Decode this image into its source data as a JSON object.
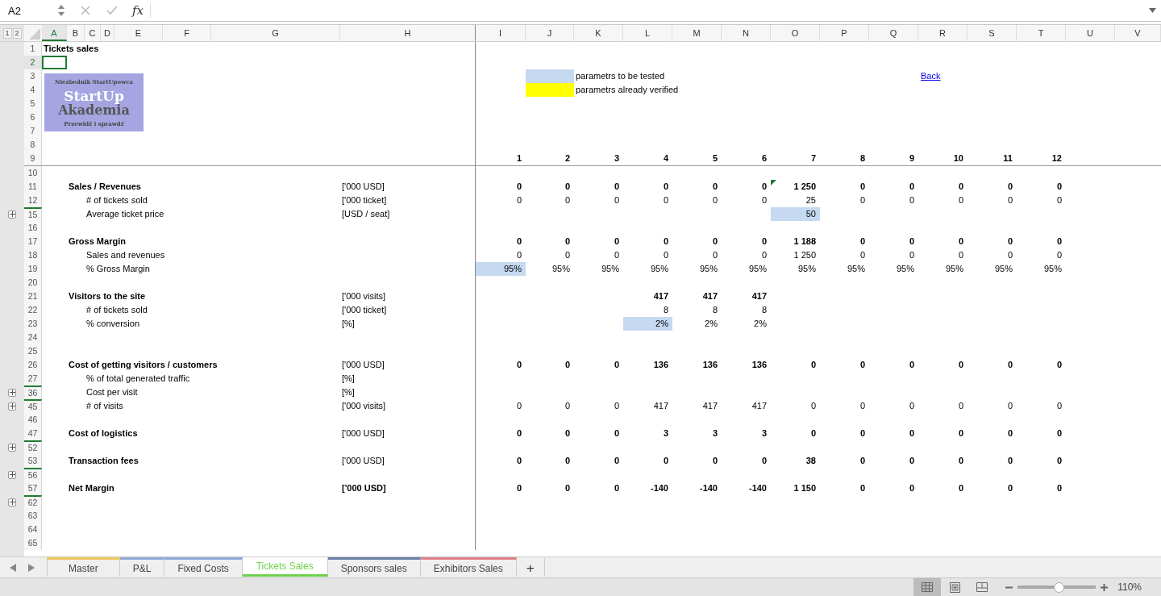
{
  "formula_bar": {
    "name_box": "A2",
    "function_label": "fx"
  },
  "outline_levels": [
    "1",
    "2"
  ],
  "logo": {
    "tagline": "Niezbednik StartUpowca",
    "title": "StartUp",
    "subtitle": "Akademia",
    "motto": "Przewidź i sprawdź"
  },
  "sheet": {
    "columns": [
      {
        "letter": "A",
        "selected": true
      },
      {
        "letter": "B",
        "selected": false
      },
      {
        "letter": "C",
        "selected": false
      },
      {
        "letter": "D",
        "selected": false
      },
      {
        "letter": "E",
        "selected": false
      },
      {
        "letter": "F",
        "selected": false
      },
      {
        "letter": "G",
        "selected": false
      },
      {
        "letter": "H",
        "selected": false
      },
      {
        "letter": "I",
        "selected": false
      },
      {
        "letter": "J",
        "selected": false
      },
      {
        "letter": "K",
        "selected": false
      },
      {
        "letter": "L",
        "selected": false
      },
      {
        "letter": "M",
        "selected": false
      },
      {
        "letter": "N",
        "selected": false
      },
      {
        "letter": "O",
        "selected": false
      },
      {
        "letter": "P",
        "selected": false
      },
      {
        "letter": "Q",
        "selected": false
      },
      {
        "letter": "R",
        "selected": false
      },
      {
        "letter": "S",
        "selected": false
      },
      {
        "letter": "T",
        "selected": false
      },
      {
        "letter": "U",
        "selected": false
      },
      {
        "letter": "V",
        "selected": false
      }
    ],
    "rows": [
      {
        "number": "1",
        "selected": false,
        "collapsed": false,
        "kind": "title",
        "label": "Tickets sales"
      },
      {
        "number": "2",
        "selected": true,
        "collapsed": false,
        "kind": "plain"
      },
      {
        "number": "3",
        "selected": false,
        "collapsed": false,
        "kind": "plain",
        "legend": {
          "color": "#c5d9f1",
          "text": "parametrs to be tested"
        },
        "link": "Back"
      },
      {
        "number": "4",
        "selected": false,
        "collapsed": false,
        "kind": "plain",
        "legend": {
          "color": "#ffff00",
          "text": "parametrs already verified"
        }
      },
      {
        "number": "5",
        "selected": false,
        "collapsed": false,
        "kind": "plain"
      },
      {
        "number": "6",
        "selected": false,
        "collapsed": false,
        "kind": "plain"
      },
      {
        "number": "7",
        "selected": false,
        "collapsed": false,
        "kind": "plain"
      },
      {
        "number": "8",
        "selected": false,
        "collapsed": false,
        "kind": "plain"
      },
      {
        "number": "9",
        "selected": false,
        "collapsed": false,
        "kind": "period",
        "cells": [
          {
            "text": "1"
          },
          {
            "text": "2"
          },
          {
            "text": "3"
          },
          {
            "text": "4"
          },
          {
            "text": "5"
          },
          {
            "text": "6"
          },
          {
            "text": "7"
          },
          {
            "text": "8"
          },
          {
            "text": "9"
          },
          {
            "text": "10"
          },
          {
            "text": "11"
          },
          {
            "text": "12"
          }
        ]
      },
      {
        "number": "10",
        "selected": false,
        "collapsed": false,
        "kind": "plain"
      },
      {
        "number": "11",
        "selected": false,
        "collapsed": false,
        "kind": "heading",
        "label": "Sales / Revenues",
        "unit": "['000 USD]",
        "cells": [
          {
            "text": "0"
          },
          {
            "text": "0"
          },
          {
            "text": "0"
          },
          {
            "text": "0"
          },
          {
            "text": "0"
          },
          {
            "text": "0"
          },
          {
            "text": "1 250",
            "flagged": true
          },
          {
            "text": "0"
          },
          {
            "text": "0"
          },
          {
            "text": "0"
          },
          {
            "text": "0"
          },
          {
            "text": "0"
          }
        ]
      },
      {
        "number": "12",
        "selected": false,
        "collapsed": false,
        "kind": "item",
        "label": "# of tickets sold",
        "unit": "['000 ticket]",
        "cells": [
          {
            "text": "0"
          },
          {
            "text": "0"
          },
          {
            "text": "0"
          },
          {
            "text": "0"
          },
          {
            "text": "0"
          },
          {
            "text": "0"
          },
          {
            "text": "25"
          },
          {
            "text": "0"
          },
          {
            "text": "0"
          },
          {
            "text": "0"
          },
          {
            "text": "0"
          },
          {
            "text": "0"
          }
        ]
      },
      {
        "number": "15",
        "selected": false,
        "collapsed": true,
        "kind": "item",
        "label": "Average ticket price",
        "unit": "[USD / seat]",
        "cells": [
          null,
          null,
          null,
          null,
          null,
          null,
          {
            "text": "50",
            "highlighted": true
          },
          null,
          null,
          null,
          null,
          null
        ]
      },
      {
        "number": "16",
        "selected": false,
        "collapsed": false,
        "kind": "plain"
      },
      {
        "number": "17",
        "selected": false,
        "collapsed": false,
        "kind": "heading",
        "label": "Gross Margin",
        "cells": [
          {
            "text": "0"
          },
          {
            "text": "0"
          },
          {
            "text": "0"
          },
          {
            "text": "0"
          },
          {
            "text": "0"
          },
          {
            "text": "0"
          },
          {
            "text": "1 188"
          },
          {
            "text": "0"
          },
          {
            "text": "0"
          },
          {
            "text": "0"
          },
          {
            "text": "0"
          },
          {
            "text": "0"
          }
        ]
      },
      {
        "number": "18",
        "selected": false,
        "collapsed": false,
        "kind": "item",
        "label": "Sales and revenues",
        "cells": [
          {
            "text": "0"
          },
          {
            "text": "0"
          },
          {
            "text": "0"
          },
          {
            "text": "0"
          },
          {
            "text": "0"
          },
          {
            "text": "0"
          },
          {
            "text": "1 250"
          },
          {
            "text": "0"
          },
          {
            "text": "0"
          },
          {
            "text": "0"
          },
          {
            "text": "0"
          },
          {
            "text": "0"
          }
        ]
      },
      {
        "number": "19",
        "selected": false,
        "collapsed": false,
        "kind": "item",
        "label": "% Gross Margin",
        "cells": [
          {
            "text": "95%",
            "highlighted": true
          },
          {
            "text": "95%"
          },
          {
            "text": "95%"
          },
          {
            "text": "95%"
          },
          {
            "text": "95%"
          },
          {
            "text": "95%"
          },
          {
            "text": "95%"
          },
          {
            "text": "95%"
          },
          {
            "text": "95%"
          },
          {
            "text": "95%"
          },
          {
            "text": "95%"
          },
          {
            "text": "95%"
          }
        ]
      },
      {
        "number": "20",
        "selected": false,
        "collapsed": false,
        "kind": "plain"
      },
      {
        "number": "21",
        "selected": false,
        "collapsed": false,
        "kind": "heading",
        "label": "Visitors to the site",
        "unit": "['000 visits]",
        "cells": [
          null,
          null,
          null,
          {
            "text": "417"
          },
          {
            "text": "417"
          },
          {
            "text": "417"
          },
          null,
          null,
          null,
          null,
          null,
          null
        ]
      },
      {
        "number": "22",
        "selected": false,
        "collapsed": false,
        "kind": "item",
        "label": "# of tickets sold",
        "unit": "['000 ticket]",
        "cells": [
          null,
          null,
          null,
          {
            "text": "8"
          },
          {
            "text": "8"
          },
          {
            "text": "8"
          },
          null,
          null,
          null,
          null,
          null,
          null
        ]
      },
      {
        "number": "23",
        "selected": false,
        "collapsed": false,
        "kind": "item",
        "label": "% conversion",
        "unit": "[%]",
        "cells": [
          null,
          null,
          null,
          {
            "text": "2%",
            "highlighted": true
          },
          {
            "text": "2%"
          },
          {
            "text": "2%"
          },
          null,
          null,
          null,
          null,
          null,
          null
        ]
      },
      {
        "number": "24",
        "selected": false,
        "collapsed": false,
        "kind": "plain"
      },
      {
        "number": "25",
        "selected": false,
        "collapsed": false,
        "kind": "plain"
      },
      {
        "number": "26",
        "selected": false,
        "collapsed": false,
        "kind": "heading",
        "label": "Cost of getting visitors / customers",
        "unit": "['000 USD]",
        "cells": [
          {
            "text": "0"
          },
          {
            "text": "0"
          },
          {
            "text": "0"
          },
          {
            "text": "136"
          },
          {
            "text": "136"
          },
          {
            "text": "136"
          },
          {
            "text": "0"
          },
          {
            "text": "0"
          },
          {
            "text": "0"
          },
          {
            "text": "0"
          },
          {
            "text": "0"
          },
          {
            "text": "0"
          }
        ]
      },
      {
        "number": "27",
        "selected": false,
        "collapsed": false,
        "kind": "item",
        "label": "% of total generated traffic",
        "unit": "[%]"
      },
      {
        "number": "36",
        "selected": false,
        "collapsed": true,
        "kind": "item",
        "label": "Cost per visit",
        "unit": "[%]"
      },
      {
        "number": "45",
        "selected": false,
        "collapsed": true,
        "kind": "item",
        "label": "# of visits",
        "unit": "['000 visits]",
        "cells": [
          {
            "text": "0"
          },
          {
            "text": "0"
          },
          {
            "text": "0"
          },
          {
            "text": "417"
          },
          {
            "text": "417"
          },
          {
            "text": "417"
          },
          {
            "text": "0"
          },
          {
            "text": "0"
          },
          {
            "text": "0"
          },
          {
            "text": "0"
          },
          {
            "text": "0"
          },
          {
            "text": "0"
          }
        ]
      },
      {
        "number": "46",
        "selected": false,
        "collapsed": false,
        "kind": "plain"
      },
      {
        "number": "47",
        "selected": false,
        "collapsed": false,
        "kind": "heading",
        "label": "Cost of logistics",
        "unit": "['000 USD]",
        "cells": [
          {
            "text": "0"
          },
          {
            "text": "0"
          },
          {
            "text": "0"
          },
          {
            "text": "3"
          },
          {
            "text": "3"
          },
          {
            "text": "3"
          },
          {
            "text": "0"
          },
          {
            "text": "0"
          },
          {
            "text": "0"
          },
          {
            "text": "0"
          },
          {
            "text": "0"
          },
          {
            "text": "0"
          }
        ]
      },
      {
        "number": "52",
        "selected": false,
        "collapsed": true,
        "kind": "plain"
      },
      {
        "number": "53",
        "selected": false,
        "collapsed": false,
        "kind": "heading",
        "label": "Transaction fees",
        "unit": "['000 USD]",
        "cells": [
          {
            "text": "0"
          },
          {
            "text": "0"
          },
          {
            "text": "0"
          },
          {
            "text": "0"
          },
          {
            "text": "0"
          },
          {
            "text": "0"
          },
          {
            "text": "38"
          },
          {
            "text": "0"
          },
          {
            "text": "0"
          },
          {
            "text": "0"
          },
          {
            "text": "0"
          },
          {
            "text": "0"
          }
        ]
      },
      {
        "number": "56",
        "selected": false,
        "collapsed": true,
        "kind": "plain"
      },
      {
        "number": "57",
        "selected": false,
        "collapsed": false,
        "kind": "total",
        "label": "Net Margin",
        "unit": "['000 USD]",
        "cells": [
          {
            "text": "0"
          },
          {
            "text": "0"
          },
          {
            "text": "0"
          },
          {
            "text": "-140"
          },
          {
            "text": "-140"
          },
          {
            "text": "-140"
          },
          {
            "text": "1 150"
          },
          {
            "text": "0"
          },
          {
            "text": "0"
          },
          {
            "text": "0"
          },
          {
            "text": "0"
          },
          {
            "text": "0"
          }
        ]
      },
      {
        "number": "62",
        "selected": false,
        "collapsed": true,
        "kind": "plain"
      },
      {
        "number": "63",
        "selected": false,
        "collapsed": false,
        "kind": "plain"
      },
      {
        "number": "64",
        "selected": false,
        "collapsed": false,
        "kind": "plain"
      },
      {
        "number": "65",
        "selected": false,
        "collapsed": false,
        "kind": "plain"
      }
    ]
  },
  "tabs": [
    {
      "label": "Master",
      "color": "#f2c75c",
      "selected": false
    },
    {
      "label": "P&L",
      "color": "#8eaad8",
      "selected": false
    },
    {
      "label": "Fixed Costs",
      "color": "#8eaad8",
      "selected": false
    },
    {
      "label": "Tickets Sales",
      "color": "#6fd14a",
      "selected": true
    },
    {
      "label": "Sponsors sales",
      "color": "#6a80a8",
      "selected": false
    },
    {
      "label": "Exhibitors Sales",
      "color": "#e08088",
      "selected": false
    }
  ],
  "add_sheet": "+",
  "status": {
    "views": [
      {
        "kind": "normal",
        "selected": true
      },
      {
        "kind": "page-layout",
        "selected": false
      },
      {
        "kind": "page-break",
        "selected": false
      }
    ],
    "zoom": {
      "level": 0.52,
      "reading": "110%"
    }
  }
}
